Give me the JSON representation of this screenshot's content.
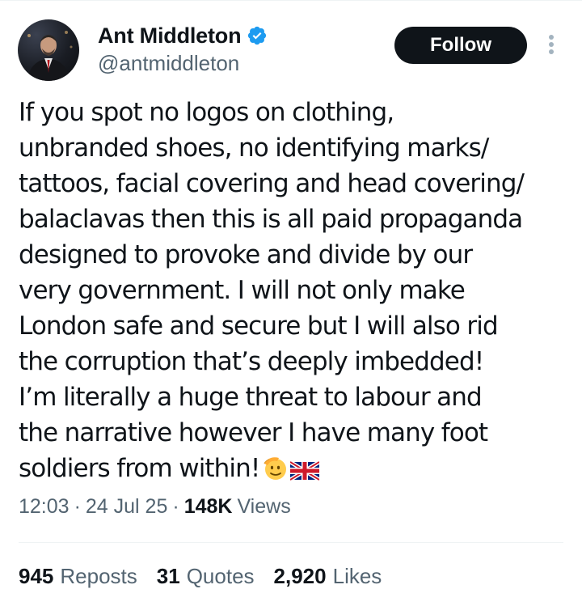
{
  "author": {
    "display_name": "Ant Middleton",
    "handle": "@antmiddleton",
    "verified": true,
    "verified_color": "#1d9bf0"
  },
  "actions": {
    "follow_label": "Follow",
    "more_icon": "more-vertical-icon"
  },
  "tweet": {
    "lines": [
      "If you spot no logos on clothing,",
      "unbranded shoes, no identifying marks/",
      "tattoos, facial covering and head covering/",
      "balaclavas then this is all paid propaganda",
      "designed to provoke and divide by our",
      "very government. I will not only make",
      "London safe and secure but I will also rid",
      "the corruption that’s deeply imbedded!",
      "I’m literally a huge threat to labour and",
      "the narrative however I have many foot",
      "soldiers from within!"
    ],
    "emojis": [
      "saluting-face-emoji",
      "uk-flag-emoji"
    ]
  },
  "meta": {
    "time": "12:03",
    "date": "24 Jul 25",
    "separator": "·",
    "views_count": "148K",
    "views_label": "Views"
  },
  "stats": [
    {
      "count": "945",
      "label": "Reposts"
    },
    {
      "count": "31",
      "label": "Quotes"
    },
    {
      "count": "2,920",
      "label": "Likes"
    }
  ],
  "colors": {
    "text": "#0f1419",
    "secondary": "#536471",
    "button_bg": "#0f1419",
    "button_text": "#ffffff",
    "divider": "#eff3f4"
  }
}
